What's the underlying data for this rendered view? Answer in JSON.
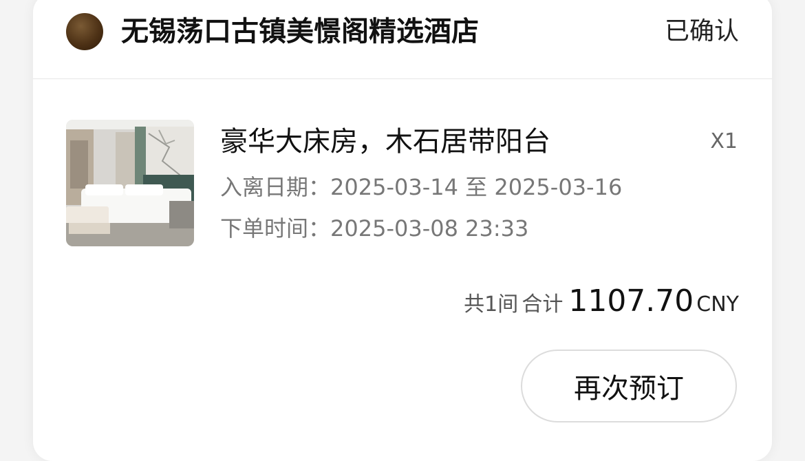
{
  "order": {
    "hotel_name": "无锡荡口古镇美憬阁精选酒店",
    "status": "已确认",
    "logo_icon": "hotel-logo-icon",
    "room": {
      "name": "豪华大床房，木石居带阳台",
      "quantity": "X1",
      "thumbnail_icon": "room-photo"
    },
    "dates": {
      "label": "入离日期：",
      "check_in": "2025-03-14",
      "separator": "至",
      "check_out": "2025-03-16"
    },
    "order_time": {
      "label": "下单时间：",
      "value": "2025-03-08 23:33"
    },
    "total": {
      "rooms_text": "共1间",
      "total_label": "合计",
      "amount": "1107.70",
      "currency": "CNY"
    },
    "rebook_label": "再次预订"
  }
}
